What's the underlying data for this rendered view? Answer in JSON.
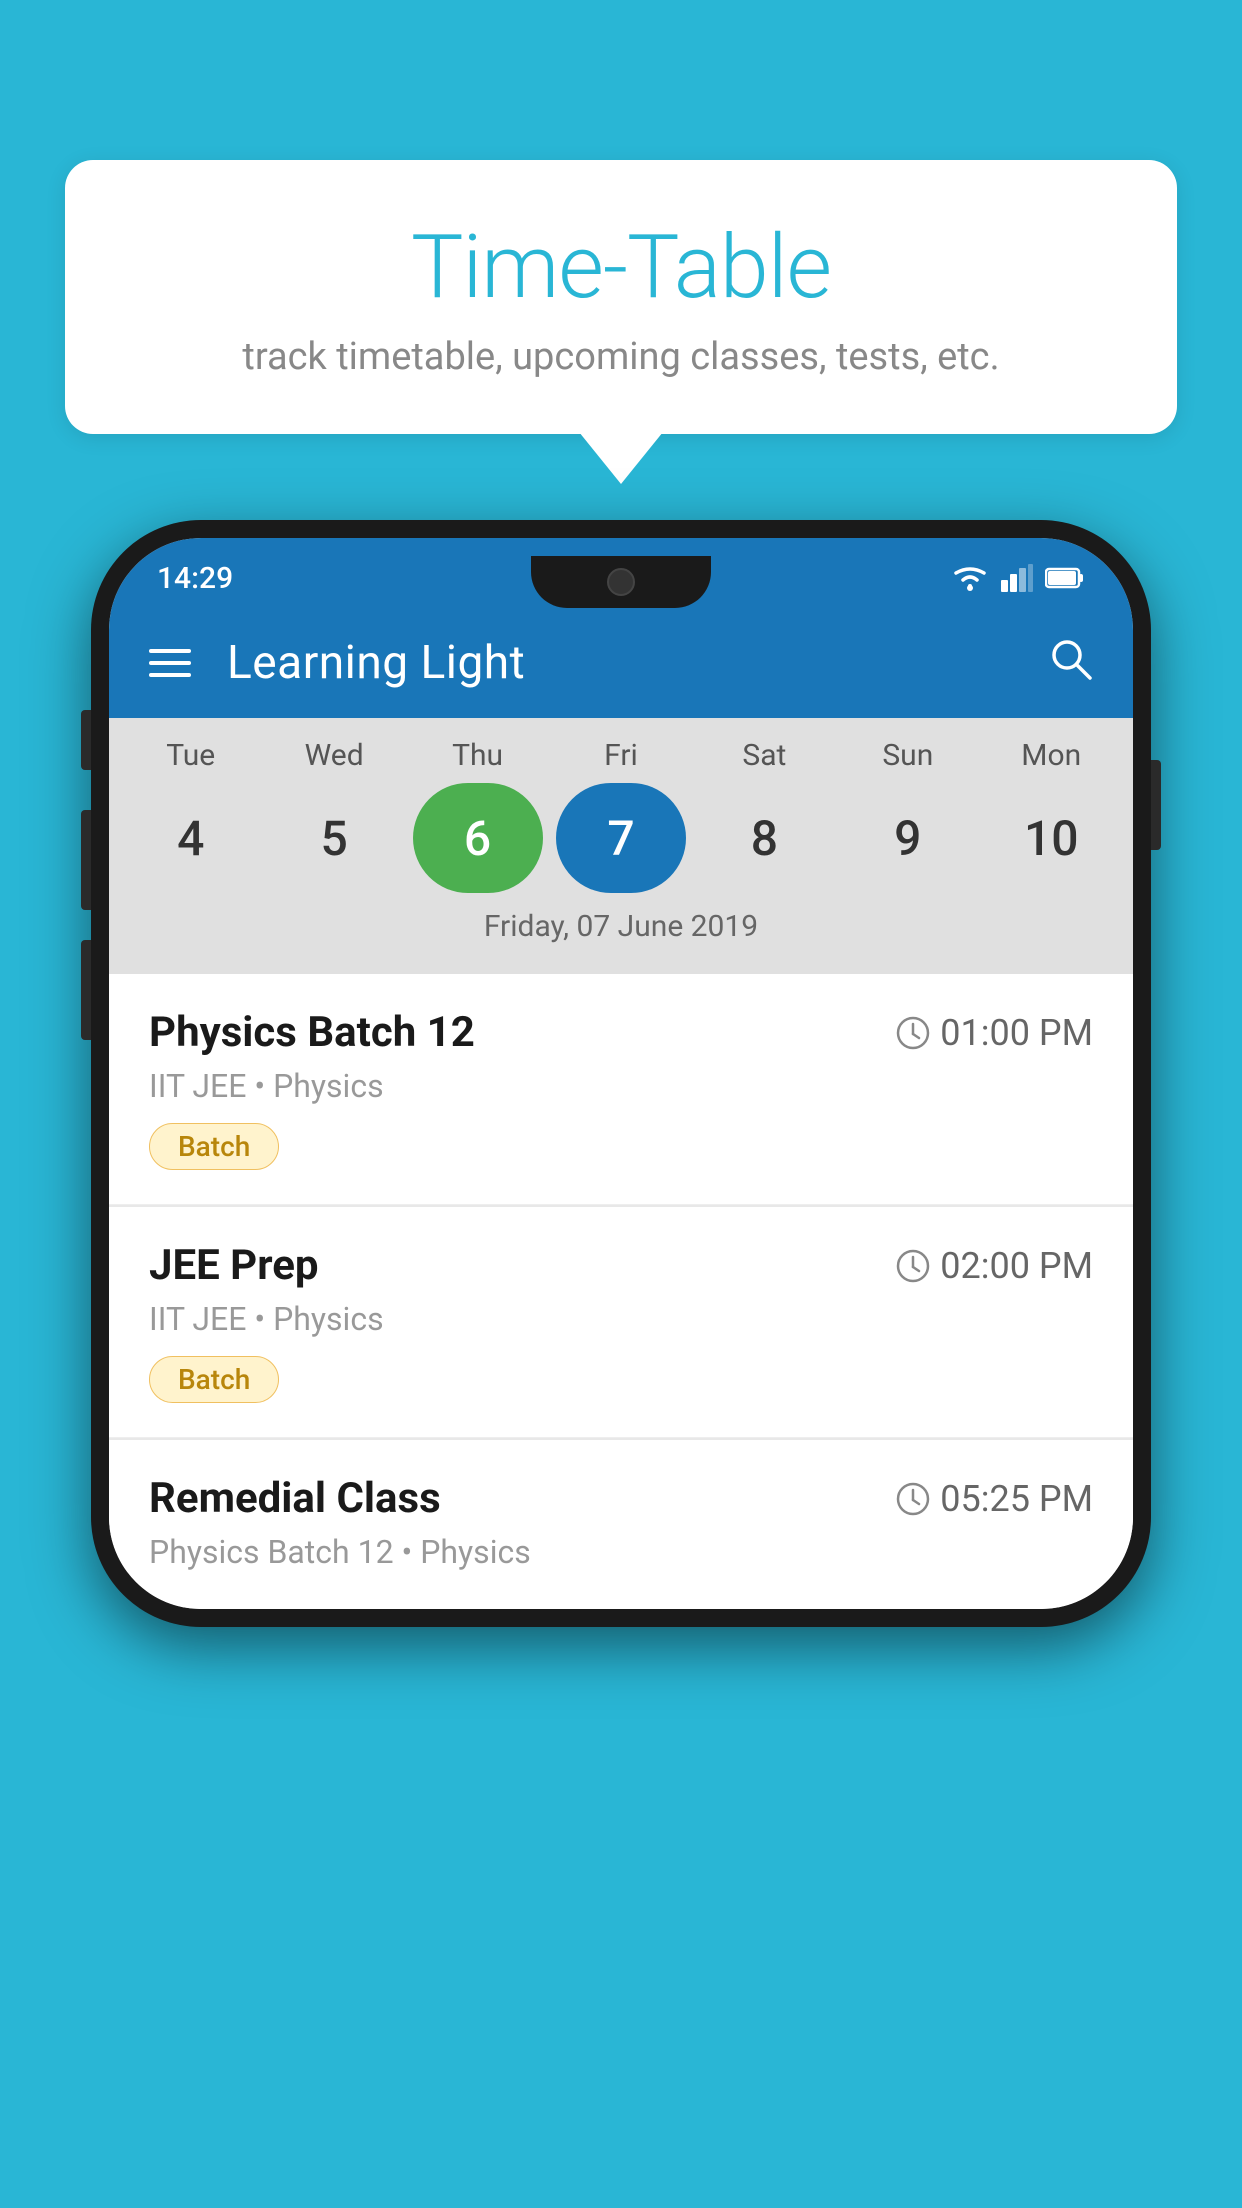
{
  "background_color": "#29B6D5",
  "speech_bubble": {
    "title": "Time-Table",
    "subtitle": "track timetable, upcoming classes, tests, etc."
  },
  "phone": {
    "status_bar": {
      "time": "14:29"
    },
    "app_bar": {
      "title": "Learning Light"
    },
    "calendar": {
      "days": [
        {
          "label": "Tue",
          "date": "4",
          "state": "normal"
        },
        {
          "label": "Wed",
          "date": "5",
          "state": "normal"
        },
        {
          "label": "Thu",
          "date": "6",
          "state": "today"
        },
        {
          "label": "Fri",
          "date": "7",
          "state": "selected"
        },
        {
          "label": "Sat",
          "date": "8",
          "state": "normal"
        },
        {
          "label": "Sun",
          "date": "9",
          "state": "normal"
        },
        {
          "label": "Mon",
          "date": "10",
          "state": "normal"
        }
      ],
      "selected_date_label": "Friday, 07 June 2019"
    },
    "classes": [
      {
        "name": "Physics Batch 12",
        "time": "01:00 PM",
        "meta": "IIT JEE • Physics",
        "badge": "Batch"
      },
      {
        "name": "JEE Prep",
        "time": "02:00 PM",
        "meta": "IIT JEE • Physics",
        "badge": "Batch"
      },
      {
        "name": "Remedial Class",
        "time": "05:25 PM",
        "meta": "Physics Batch 12 • Physics",
        "badge": null
      }
    ]
  }
}
